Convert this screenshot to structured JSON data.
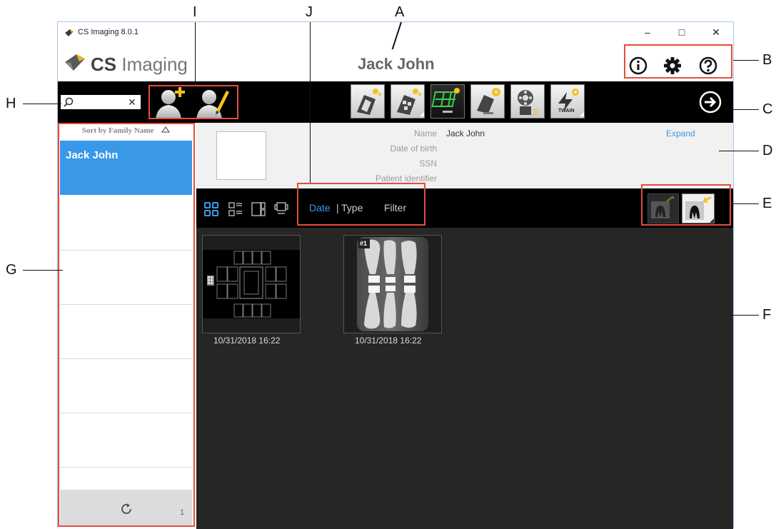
{
  "window": {
    "title": "CS Imaging 8.0.1",
    "app_name": "CS Imaging",
    "minimize": "–",
    "maximize": "□",
    "close": "✕"
  },
  "header": {
    "patient_name": "Jack John",
    "icons": [
      "info-icon",
      "settings-gear-icon",
      "help-icon"
    ]
  },
  "search": {
    "placeholder": "",
    "clear": "✕"
  },
  "toolbar": {
    "acquisition_tools": [
      "intraoral-acquisition",
      "sensor-acquisition",
      "panoramic-acquisition",
      "device-settings",
      "film-scanner",
      "twain-import"
    ],
    "twain_label": "TWAIN",
    "next_icon": "arrow-right-circle-icon"
  },
  "sidebar": {
    "sort_label": "Sort by Family Name",
    "sort_icon": "triangle-up-icon",
    "patients": [
      "Jack John"
    ],
    "count": "1",
    "refresh_icon": "refresh-icon"
  },
  "patient_info": {
    "name_label": "Name",
    "name_value": "Jack John",
    "dob_label": "Date of birth",
    "ssn_label": "SSN",
    "id_label": "Patient identifier",
    "expand": "Expand"
  },
  "viewbar": {
    "sort_date": "Date",
    "separator": "|",
    "sort_type": "Type",
    "filter": "Filter",
    "view_icons": [
      "grid-view-icon",
      "list-view-icon",
      "split-view-icon",
      "slide-view-icon"
    ]
  },
  "images": [
    {
      "date": "10/31/2018 16:22",
      "kind": "fmx-template"
    },
    {
      "date": "10/31/2018 16:22",
      "kind": "bitewing",
      "badge": "#1"
    }
  ],
  "callouts": {
    "A": "A",
    "B": "B",
    "C": "C",
    "D": "D",
    "E": "E",
    "F": "F",
    "G": "G",
    "H": "H",
    "I": "I",
    "J": "J"
  },
  "colors": {
    "accent": "#3a98e8",
    "callout_box": "#e74c3c",
    "toolbar": "#000000",
    "content_bg": "#262626"
  }
}
